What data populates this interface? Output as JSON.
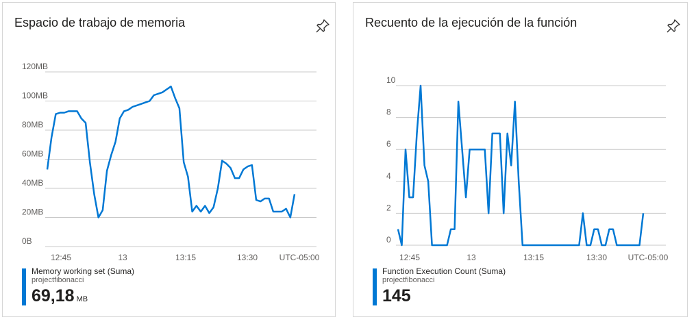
{
  "chart_data": [
    {
      "type": "line",
      "title": "Espacio de trabajo de memoria",
      "y_tick_labels": [
        "120MB",
        "100MB",
        "80MB",
        "60MB",
        "40MB",
        "20MB",
        "0B"
      ],
      "x_tick_labels": [
        "12:45",
        "13",
        "13:15",
        "13:30",
        "UTC-05:00"
      ],
      "ylim": [
        0,
        120
      ],
      "y_unit": "MB",
      "grid": true,
      "x": [
        "12:39",
        "12:40",
        "12:41",
        "12:42",
        "12:43",
        "12:44",
        "12:45",
        "12:46",
        "12:47",
        "12:48",
        "12:49",
        "12:50",
        "12:51",
        "12:52",
        "12:53",
        "12:54",
        "12:55",
        "12:56",
        "12:57",
        "12:58",
        "12:59",
        "13:00",
        "13:01",
        "13:02",
        "13:03",
        "13:04",
        "13:05",
        "13:06",
        "13:07",
        "13:08",
        "13:09",
        "13:10",
        "13:11",
        "13:12",
        "13:13",
        "13:14",
        "13:15",
        "13:16",
        "13:17",
        "13:18",
        "13:19",
        "13:20",
        "13:21",
        "13:22",
        "13:23",
        "13:24",
        "13:25",
        "13:26",
        "13:27",
        "13:28",
        "13:29",
        "13:30",
        "13:31",
        "13:32",
        "13:33",
        "13:34",
        "13:35",
        "13:36",
        "13:37",
        "13:38",
        "13:39"
      ],
      "series": [
        {
          "name": "Memory working set (Suma)",
          "color": "#0078d4",
          "values": [
            53,
            75,
            91,
            92,
            92,
            93,
            93,
            93,
            88,
            85,
            58,
            36,
            20,
            25,
            52,
            63,
            72,
            88,
            93,
            94,
            96,
            97,
            98,
            99,
            100,
            104,
            105,
            106,
            108,
            110,
            102,
            95,
            58,
            48,
            24,
            28,
            24,
            28,
            23,
            27,
            40,
            59,
            57,
            54,
            47,
            47,
            53,
            55,
            56,
            32,
            31,
            33,
            33,
            24,
            24,
            24,
            26,
            20,
            36
          ]
        }
      ],
      "legend": {
        "series": "Memory working set (Suma)",
        "resource": "projectfibonacci",
        "total": "69,18",
        "unit": "MB"
      }
    },
    {
      "type": "line",
      "title": "Recuento de la ejecución de la función",
      "y_tick_labels": [
        "10",
        "8",
        "6",
        "4",
        "2",
        "0"
      ],
      "x_tick_labels": [
        "12:45",
        "13",
        "13:15",
        "13:30",
        "UTC-05:00"
      ],
      "ylim": [
        0,
        10
      ],
      "grid": true,
      "x": [
        "12:39",
        "12:40",
        "12:41",
        "12:42",
        "12:43",
        "12:44",
        "12:45",
        "12:46",
        "12:47",
        "12:48",
        "12:49",
        "12:50",
        "12:51",
        "12:52",
        "12:53",
        "12:54",
        "12:55",
        "12:56",
        "12:57",
        "12:58",
        "12:59",
        "13:00",
        "13:01",
        "13:02",
        "13:03",
        "13:04",
        "13:05",
        "13:06",
        "13:07",
        "13:08",
        "13:09",
        "13:10",
        "13:11",
        "13:12",
        "13:13",
        "13:14",
        "13:15",
        "13:16",
        "13:17",
        "13:18",
        "13:19",
        "13:20",
        "13:21",
        "13:22",
        "13:23",
        "13:24",
        "13:25",
        "13:26",
        "13:27",
        "13:28",
        "13:29",
        "13:30",
        "13:31",
        "13:32",
        "13:33",
        "13:34",
        "13:35",
        "13:36",
        "13:37",
        "13:38"
      ],
      "series": [
        {
          "name": "Function Execution Count (Suma)",
          "color": "#0078d4",
          "values": [
            1,
            0,
            6,
            3,
            3,
            7,
            10,
            5,
            4,
            0,
            0,
            0,
            0,
            0,
            1,
            1,
            9,
            6,
            3,
            6,
            6,
            6,
            6,
            6,
            2,
            7,
            7,
            7,
            2,
            7,
            5,
            9,
            4,
            0,
            0,
            0,
            0,
            0,
            0,
            0,
            0,
            0,
            0,
            0,
            0,
            0,
            0,
            0,
            0,
            2,
            0,
            0,
            1,
            1,
            0,
            0,
            1,
            1,
            0,
            0,
            0,
            0,
            0,
            0,
            0,
            2
          ]
        }
      ],
      "legend": {
        "series": "Function Execution Count (Suma)",
        "resource": "projectfibonacci",
        "total": "145",
        "unit": ""
      }
    }
  ],
  "icons": {
    "pin": "pin-icon"
  }
}
